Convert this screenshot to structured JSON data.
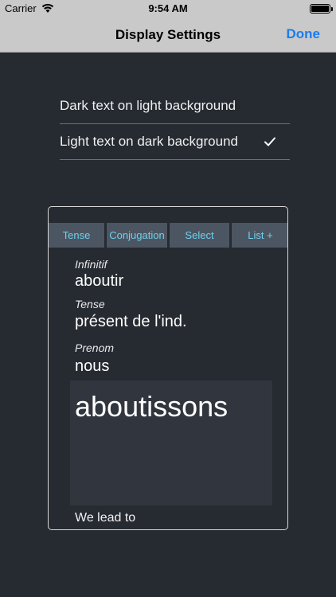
{
  "status": {
    "carrier": "Carrier",
    "time": "9:54 AM"
  },
  "nav": {
    "title": "Display Settings",
    "done": "Done"
  },
  "options": [
    {
      "label": "Dark text on light background",
      "selected": false
    },
    {
      "label": "Light text on dark background",
      "selected": true
    }
  ],
  "preview": {
    "tabs": [
      "Tense",
      "Conjugation",
      "Select",
      "List +"
    ],
    "infinitif_label": "Infinitif",
    "infinitif_value": "aboutir",
    "tense_label": "Tense",
    "tense_value": "présent de l'ind.",
    "prenom_label": "Prenom",
    "prenom_value": "nous",
    "result": "aboutissons",
    "translation": "We lead to"
  },
  "colors": {
    "background": "#262a31",
    "bar": "#c9c9c9",
    "accent": "#1a7cf2",
    "tab_bg": "#4c5662",
    "tab_text": "#6ed0ef"
  }
}
